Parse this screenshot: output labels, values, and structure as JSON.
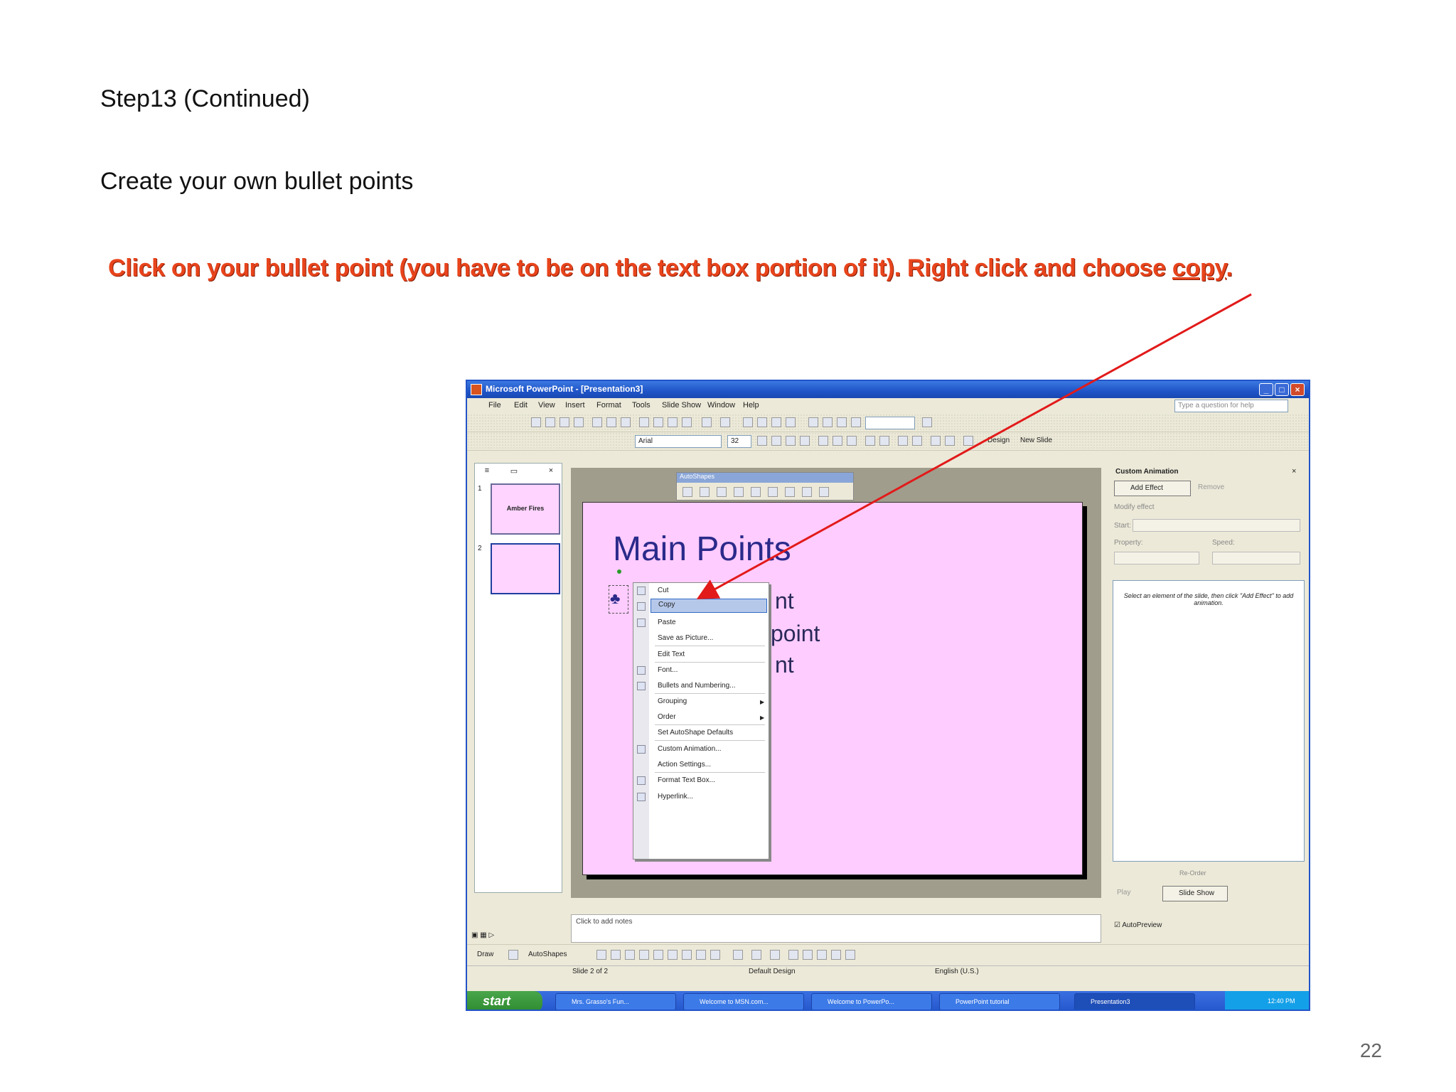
{
  "heading": "Step13 (Continued)",
  "subheading": "Create your own bullet points",
  "instruction_before": "Click on your bullet point (you have to be on the text box portion of it). Right click and choose ",
  "instruction_underlined": "copy",
  "instruction_after": ".",
  "page_number": "22",
  "colors": {
    "instruction": "#e8441c",
    "arrow": "#e21a1a",
    "slide_bg": "#ffccff",
    "title_text": "#2a2a8a"
  },
  "window": {
    "title": "Microsoft PowerPoint - [Presentation3]",
    "help_placeholder": "Type a question for help"
  },
  "menu": [
    "File",
    "Edit",
    "View",
    "Insert",
    "Format",
    "Tools",
    "Slide Show",
    "Window",
    "Help"
  ],
  "formatting": {
    "font": "Arial",
    "size": "32",
    "design_label": "Design",
    "new_slide_label": "New Slide"
  },
  "thumbnails": [
    {
      "number": "1",
      "label": "Amber Fires"
    },
    {
      "number": "2",
      "label": ""
    }
  ],
  "slide": {
    "title": "Main Points",
    "bullet_fragments": [
      "nt",
      "point",
      "nt"
    ]
  },
  "autoshapes_toolbar": {
    "title": "AutoShapes"
  },
  "context_menu": {
    "items": [
      {
        "label": "Cut",
        "icon": "scissors-icon"
      },
      {
        "label": "Copy",
        "icon": "copy-icon",
        "selected": true
      },
      {
        "label": "Paste",
        "icon": "paste-icon"
      },
      {
        "label": "Save as Picture...",
        "icon": ""
      },
      {
        "label": "Edit Text",
        "icon": ""
      },
      {
        "label": "Font...",
        "icon": "font-icon"
      },
      {
        "label": "Bullets and Numbering...",
        "icon": "bullets-icon"
      },
      {
        "label": "Grouping",
        "icon": "",
        "submenu": true
      },
      {
        "label": "Order",
        "icon": "",
        "submenu": true
      },
      {
        "label": "Set AutoShape Defaults",
        "icon": ""
      },
      {
        "label": "Custom Animation...",
        "icon": "animation-icon"
      },
      {
        "label": "Action Settings...",
        "icon": ""
      },
      {
        "label": "Format Text Box...",
        "icon": "format-icon"
      },
      {
        "label": "Hyperlink...",
        "icon": "hyperlink-icon"
      }
    ]
  },
  "task_pane": {
    "title": "Custom Animation",
    "add_effect": "Add Effect",
    "remove": "Remove",
    "modify_label": "Modify effect",
    "start_label": "Start:",
    "property_label": "Property:",
    "speed_label": "Speed:",
    "list_message": "Select an element of the slide, then click \"Add Effect\" to add animation.",
    "reorder": "Re-Order",
    "play": "Play",
    "slide_show": "Slide Show",
    "autopreview": "AutoPreview"
  },
  "notes_placeholder": "Click to add notes",
  "drawing": {
    "draw": "Draw",
    "autoshapes": "AutoShapes"
  },
  "status": {
    "slide": "Slide 2 of 2",
    "design": "Default Design",
    "language": "English (U.S.)"
  },
  "taskbar": {
    "start": "start",
    "tasks": [
      "Mrs. Grasso's Fun...",
      "Welcome to MSN.com...",
      "Welcome to PowerPo...",
      "PowerPoint tutorial",
      "Presentation3"
    ],
    "clock": "12:40 PM"
  }
}
